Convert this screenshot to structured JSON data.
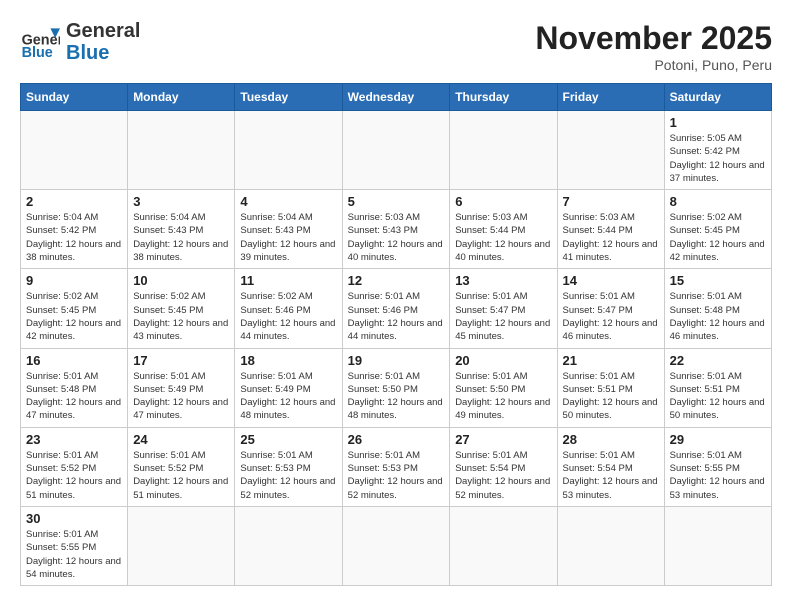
{
  "header": {
    "logo_general": "General",
    "logo_blue": "Blue",
    "month_title": "November 2025",
    "subtitle": "Potoni, Puno, Peru"
  },
  "days_of_week": [
    "Sunday",
    "Monday",
    "Tuesday",
    "Wednesday",
    "Thursday",
    "Friday",
    "Saturday"
  ],
  "weeks": [
    [
      {
        "day": "",
        "info": ""
      },
      {
        "day": "",
        "info": ""
      },
      {
        "day": "",
        "info": ""
      },
      {
        "day": "",
        "info": ""
      },
      {
        "day": "",
        "info": ""
      },
      {
        "day": "",
        "info": ""
      },
      {
        "day": "1",
        "info": "Sunrise: 5:05 AM\nSunset: 5:42 PM\nDaylight: 12 hours and 37 minutes."
      }
    ],
    [
      {
        "day": "2",
        "info": "Sunrise: 5:04 AM\nSunset: 5:42 PM\nDaylight: 12 hours and 38 minutes."
      },
      {
        "day": "3",
        "info": "Sunrise: 5:04 AM\nSunset: 5:43 PM\nDaylight: 12 hours and 38 minutes."
      },
      {
        "day": "4",
        "info": "Sunrise: 5:04 AM\nSunset: 5:43 PM\nDaylight: 12 hours and 39 minutes."
      },
      {
        "day": "5",
        "info": "Sunrise: 5:03 AM\nSunset: 5:43 PM\nDaylight: 12 hours and 40 minutes."
      },
      {
        "day": "6",
        "info": "Sunrise: 5:03 AM\nSunset: 5:44 PM\nDaylight: 12 hours and 40 minutes."
      },
      {
        "day": "7",
        "info": "Sunrise: 5:03 AM\nSunset: 5:44 PM\nDaylight: 12 hours and 41 minutes."
      },
      {
        "day": "8",
        "info": "Sunrise: 5:02 AM\nSunset: 5:45 PM\nDaylight: 12 hours and 42 minutes."
      }
    ],
    [
      {
        "day": "9",
        "info": "Sunrise: 5:02 AM\nSunset: 5:45 PM\nDaylight: 12 hours and 42 minutes."
      },
      {
        "day": "10",
        "info": "Sunrise: 5:02 AM\nSunset: 5:45 PM\nDaylight: 12 hours and 43 minutes."
      },
      {
        "day": "11",
        "info": "Sunrise: 5:02 AM\nSunset: 5:46 PM\nDaylight: 12 hours and 44 minutes."
      },
      {
        "day": "12",
        "info": "Sunrise: 5:01 AM\nSunset: 5:46 PM\nDaylight: 12 hours and 44 minutes."
      },
      {
        "day": "13",
        "info": "Sunrise: 5:01 AM\nSunset: 5:47 PM\nDaylight: 12 hours and 45 minutes."
      },
      {
        "day": "14",
        "info": "Sunrise: 5:01 AM\nSunset: 5:47 PM\nDaylight: 12 hours and 46 minutes."
      },
      {
        "day": "15",
        "info": "Sunrise: 5:01 AM\nSunset: 5:48 PM\nDaylight: 12 hours and 46 minutes."
      }
    ],
    [
      {
        "day": "16",
        "info": "Sunrise: 5:01 AM\nSunset: 5:48 PM\nDaylight: 12 hours and 47 minutes."
      },
      {
        "day": "17",
        "info": "Sunrise: 5:01 AM\nSunset: 5:49 PM\nDaylight: 12 hours and 47 minutes."
      },
      {
        "day": "18",
        "info": "Sunrise: 5:01 AM\nSunset: 5:49 PM\nDaylight: 12 hours and 48 minutes."
      },
      {
        "day": "19",
        "info": "Sunrise: 5:01 AM\nSunset: 5:50 PM\nDaylight: 12 hours and 48 minutes."
      },
      {
        "day": "20",
        "info": "Sunrise: 5:01 AM\nSunset: 5:50 PM\nDaylight: 12 hours and 49 minutes."
      },
      {
        "day": "21",
        "info": "Sunrise: 5:01 AM\nSunset: 5:51 PM\nDaylight: 12 hours and 50 minutes."
      },
      {
        "day": "22",
        "info": "Sunrise: 5:01 AM\nSunset: 5:51 PM\nDaylight: 12 hours and 50 minutes."
      }
    ],
    [
      {
        "day": "23",
        "info": "Sunrise: 5:01 AM\nSunset: 5:52 PM\nDaylight: 12 hours and 51 minutes."
      },
      {
        "day": "24",
        "info": "Sunrise: 5:01 AM\nSunset: 5:52 PM\nDaylight: 12 hours and 51 minutes."
      },
      {
        "day": "25",
        "info": "Sunrise: 5:01 AM\nSunset: 5:53 PM\nDaylight: 12 hours and 52 minutes."
      },
      {
        "day": "26",
        "info": "Sunrise: 5:01 AM\nSunset: 5:53 PM\nDaylight: 12 hours and 52 minutes."
      },
      {
        "day": "27",
        "info": "Sunrise: 5:01 AM\nSunset: 5:54 PM\nDaylight: 12 hours and 52 minutes."
      },
      {
        "day": "28",
        "info": "Sunrise: 5:01 AM\nSunset: 5:54 PM\nDaylight: 12 hours and 53 minutes."
      },
      {
        "day": "29",
        "info": "Sunrise: 5:01 AM\nSunset: 5:55 PM\nDaylight: 12 hours and 53 minutes."
      }
    ],
    [
      {
        "day": "30",
        "info": "Sunrise: 5:01 AM\nSunset: 5:55 PM\nDaylight: 12 hours and 54 minutes."
      },
      {
        "day": "",
        "info": ""
      },
      {
        "day": "",
        "info": ""
      },
      {
        "day": "",
        "info": ""
      },
      {
        "day": "",
        "info": ""
      },
      {
        "day": "",
        "info": ""
      },
      {
        "day": "",
        "info": ""
      }
    ]
  ]
}
